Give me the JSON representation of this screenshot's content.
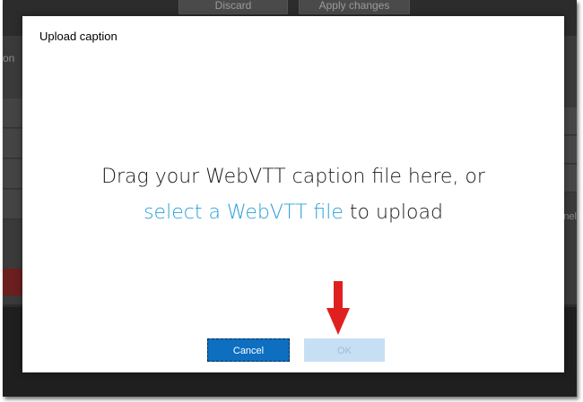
{
  "background": {
    "toolbar_buttons": [
      "Discard",
      "Apply changes"
    ],
    "left_fragment": "on",
    "right_fragment": "nel"
  },
  "modal": {
    "title": "Upload caption",
    "drop_text_prefix": "Drag your WebVTT caption file here, or",
    "drop_link": "select a WebVTT file",
    "drop_text_suffix": " to upload",
    "cancel_label": "Cancel",
    "ok_label": "OK",
    "ok_state": "disabled"
  },
  "annotation": {
    "icon": "red-arrow-down-icon",
    "color": "#e02020"
  },
  "colors": {
    "link": "#2b9fd9",
    "primary_button": "#0e6fc1",
    "disabled_button": "#c7dff4"
  }
}
